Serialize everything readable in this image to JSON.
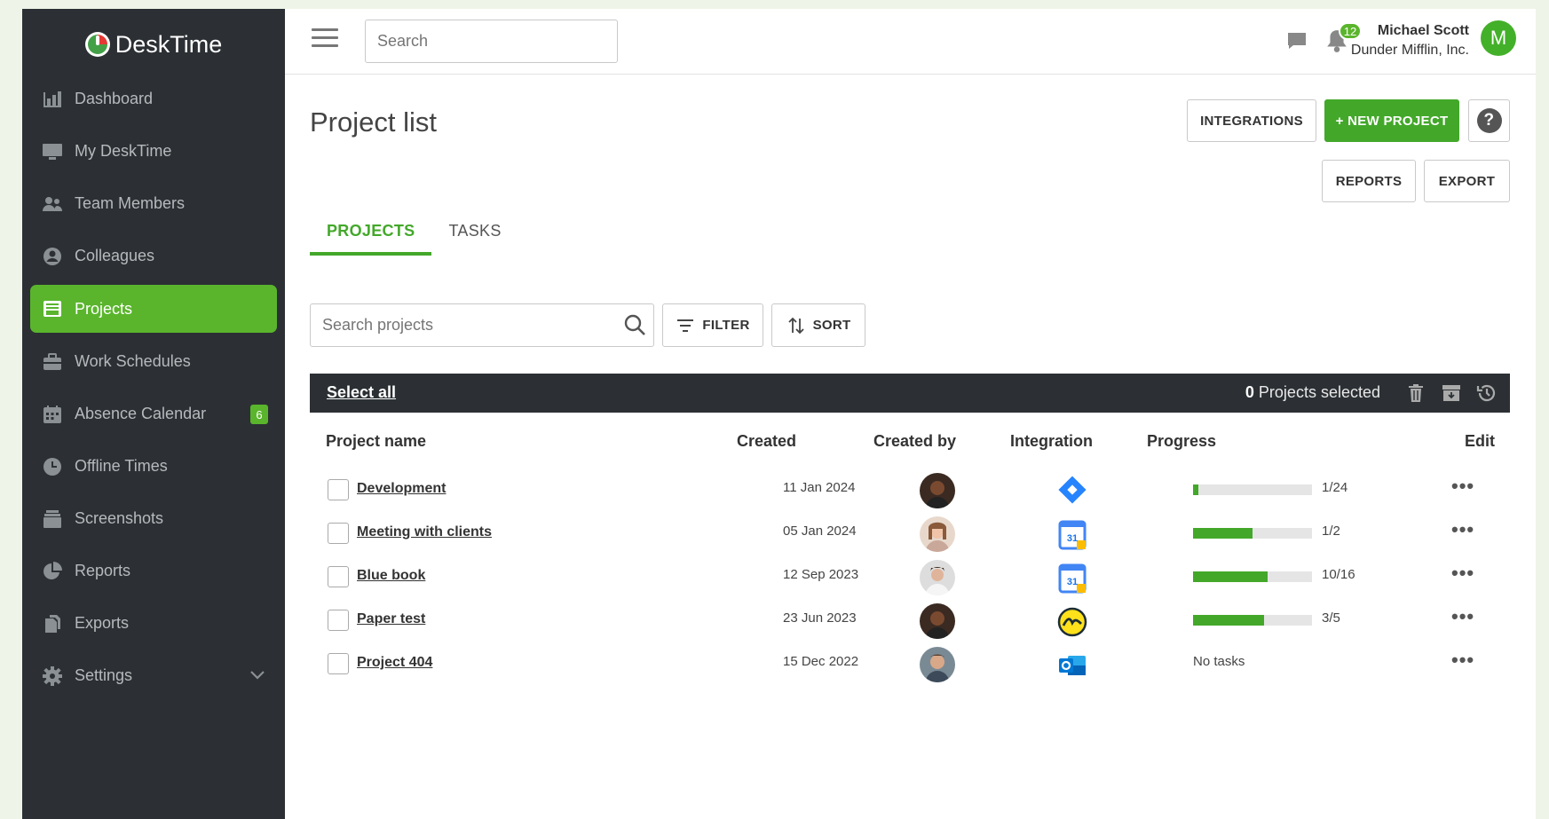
{
  "app": {
    "name": "DeskTime"
  },
  "sidebar": {
    "items": [
      {
        "label": "Dashboard",
        "icon": "bar-chart-icon",
        "active": false
      },
      {
        "label": "My DeskTime",
        "icon": "monitor-icon",
        "active": false
      },
      {
        "label": "Team Members",
        "icon": "team-icon",
        "active": false
      },
      {
        "label": "Colleagues",
        "icon": "person-circle-icon",
        "active": false
      },
      {
        "label": "Projects",
        "icon": "folder-icon",
        "active": true
      },
      {
        "label": "Work Schedules",
        "icon": "briefcase-icon",
        "active": false
      },
      {
        "label": "Absence Calendar",
        "icon": "calendar-icon",
        "active": false,
        "badge": "6"
      },
      {
        "label": "Offline Times",
        "icon": "clock-icon",
        "active": false
      },
      {
        "label": "Screenshots",
        "icon": "screenshots-icon",
        "active": false
      },
      {
        "label": "Reports",
        "icon": "pie-chart-icon",
        "active": false
      },
      {
        "label": "Exports",
        "icon": "export-files-icon",
        "active": false
      },
      {
        "label": "Settings",
        "icon": "gear-icon",
        "active": false
      }
    ]
  },
  "topbar": {
    "search_placeholder": "Search",
    "notifications_count": "12",
    "user_name": "Michael Scott",
    "company": "Dunder Mifflin, Inc.",
    "avatar_initial": "M"
  },
  "page": {
    "title": "Project list",
    "buttons": {
      "integrations": "INTEGRATIONS",
      "new_project": "+ NEW PROJECT",
      "help": "?",
      "reports": "REPORTS",
      "export": "EXPORT"
    },
    "tabs": [
      {
        "label": "PROJECTS",
        "active": true
      },
      {
        "label": "TASKS",
        "active": false
      }
    ],
    "search_placeholder": "Search projects",
    "filter_label": "FILTER",
    "sort_label": "SORT"
  },
  "selection_bar": {
    "select_all": "Select all",
    "count": "0",
    "count_suffix": " Projects selected"
  },
  "table": {
    "columns": [
      "Project name",
      "Created",
      "Created by",
      "Integration",
      "Progress",
      "Edit"
    ],
    "rows": [
      {
        "name": "Development",
        "created": "11 Jan 2024",
        "integration": "jira-icon",
        "progress_text": "1/24",
        "progress": 0.0417
      },
      {
        "name": "Meeting with clients",
        "created": "05 Jan 2024",
        "integration": "google-calendar-icon",
        "progress_text": "1/2",
        "progress": 0.5
      },
      {
        "name": "Blue book",
        "created": "12 Sep 2023",
        "integration": "google-calendar-icon",
        "progress_text": "10/16",
        "progress": 0.625
      },
      {
        "name": "Paper test",
        "created": "23 Jun 2023",
        "integration": "basecamp-icon",
        "progress_text": "3/5",
        "progress": 0.6
      },
      {
        "name": "Project 404",
        "created": "15 Dec 2022",
        "integration": "outlook-icon",
        "progress_text": "No tasks",
        "progress": null
      }
    ],
    "edit_icon": "more-dots-icon"
  },
  "colors": {
    "accent": "#43a82a",
    "sidebar_bg": "#2c3034",
    "sidebar_active": "#5ab52c"
  }
}
